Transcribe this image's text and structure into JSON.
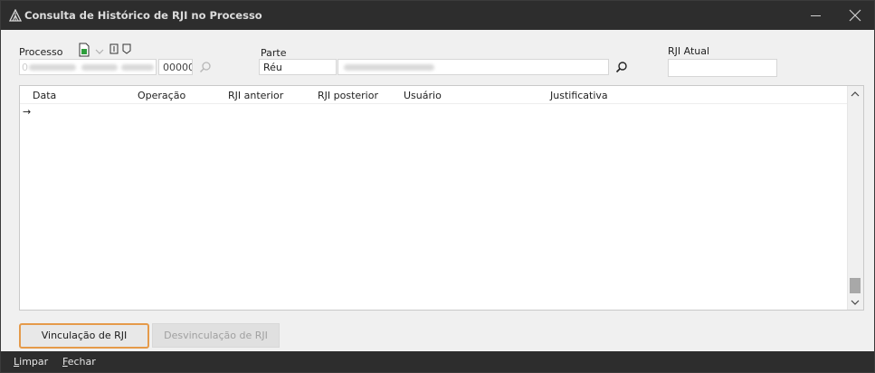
{
  "window": {
    "title": "Consulta de Histórico de RJI no Processo"
  },
  "form": {
    "processo_label": "Processo",
    "processo_number_blurred": "0",
    "processo_suffix": "00000",
    "parte_label": "Parte",
    "parte_tipo": "Réu",
    "rji_atual_label": "RJI Atual",
    "rji_atual_value": ""
  },
  "grid": {
    "columns": [
      "Data",
      "Operação",
      "RJI anterior",
      "RJI posterior",
      "Usuário",
      "Justificativa"
    ],
    "row_indicator": "→"
  },
  "buttons": {
    "vinculacao": "Vinculação de RJI",
    "desvinculacao": "Desvinculação de RJI"
  },
  "statusbar": {
    "limpar_first": "L",
    "limpar_rest": "impar",
    "fechar_first": "F",
    "fechar_rest": "echar"
  },
  "icons": {
    "app": "app-triangle-icon",
    "close": "close-icon",
    "minimize": "minimize-icon",
    "document_green": "document-icon",
    "chevron": "chevron-down-icon",
    "bracket_buttons": "bracket-icon",
    "search": "search-icon"
  },
  "colors": {
    "titlebar": "#2d2d2d",
    "accent_button_border": "#e59a4a",
    "doc_icon_green": "#2e9e3c"
  }
}
